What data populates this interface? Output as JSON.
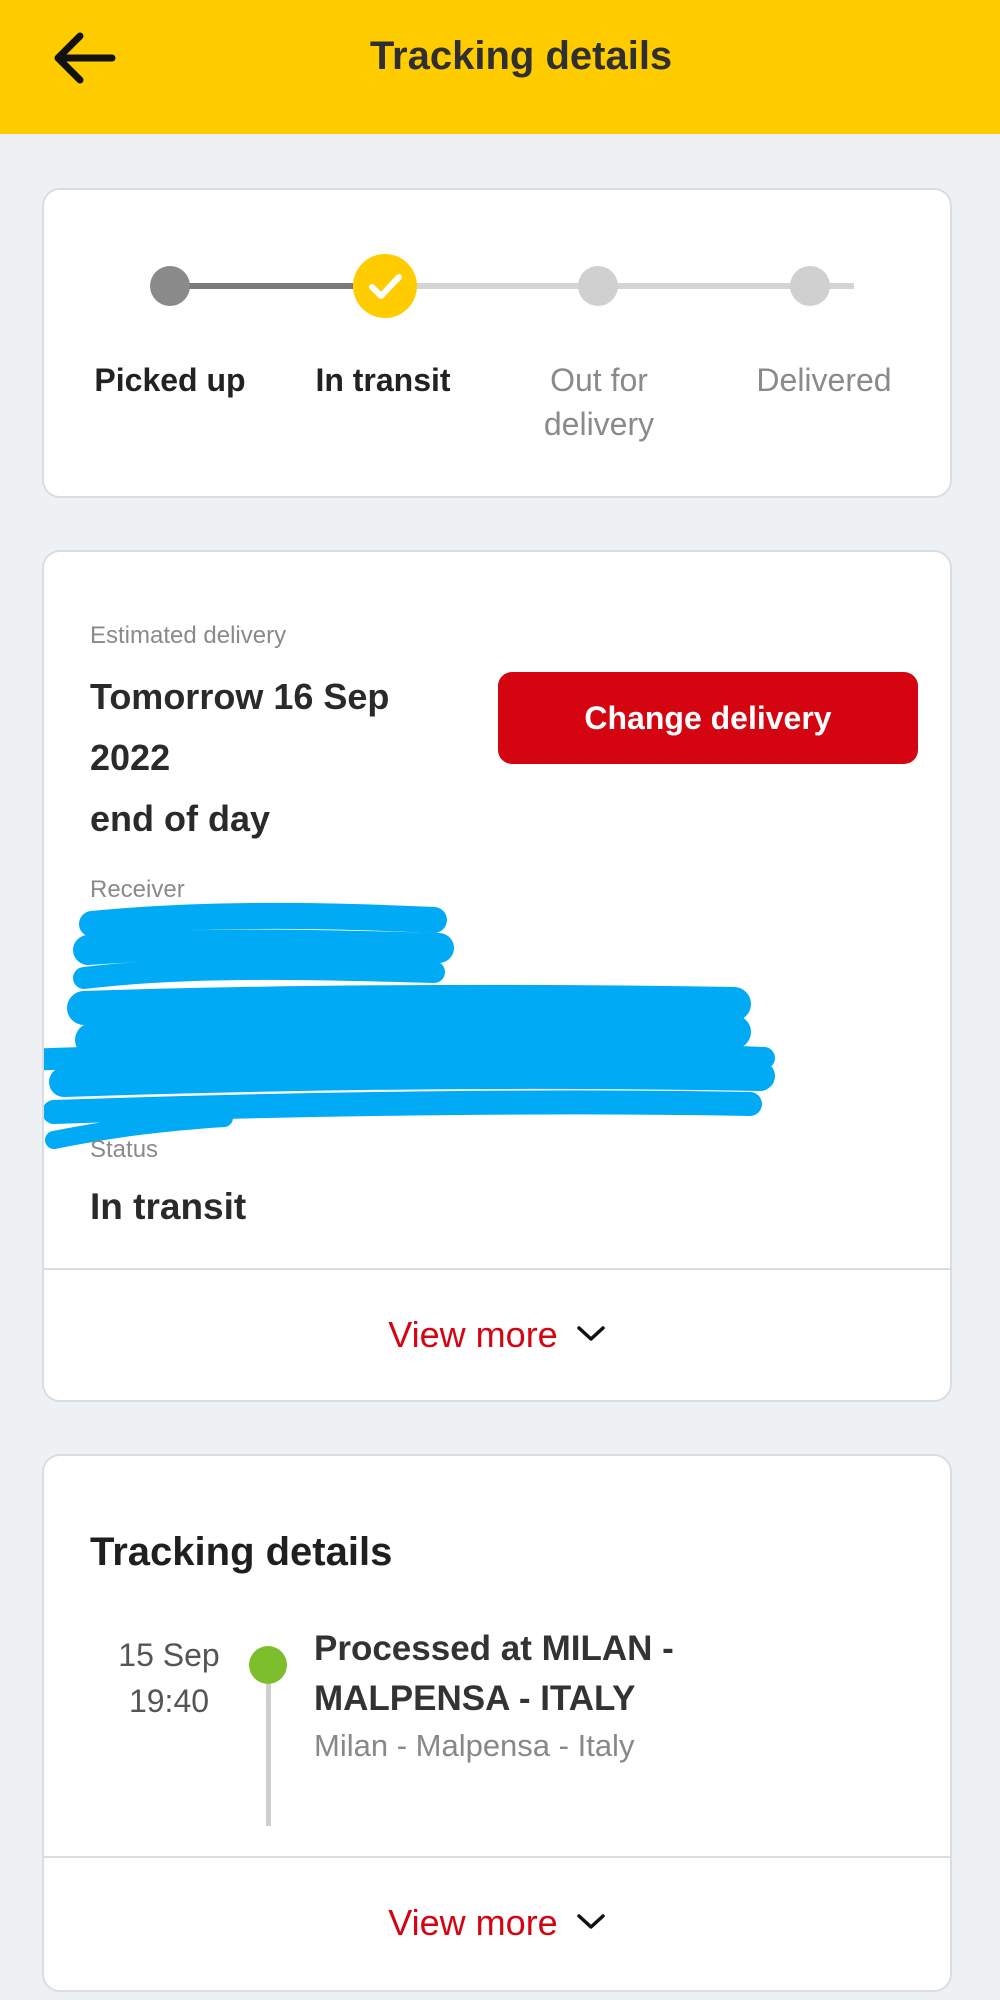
{
  "header": {
    "title": "Tracking details"
  },
  "progress": {
    "steps": [
      {
        "label": "Picked up",
        "state": "done"
      },
      {
        "label": "In transit",
        "state": "current"
      },
      {
        "label": "Out for delivery",
        "state": "pending"
      },
      {
        "label": "Delivered",
        "state": "pending"
      }
    ]
  },
  "delivery": {
    "estimated_label": "Estimated delivery",
    "date_line1": "Tomorrow 16 Sep",
    "date_line2": "2022",
    "date_line3": "end of day",
    "change_button": "Change delivery",
    "receiver_label": "Receiver",
    "status_label": "Status",
    "status_value": "In transit",
    "view_more": "View more"
  },
  "tracking": {
    "title": "Tracking details",
    "events": [
      {
        "date": "15 Sep",
        "time": "19:40",
        "title": "Processed at MILAN - MALPENSA - ITALY",
        "location": "Milan - Malpensa - Italy"
      }
    ],
    "view_more": "View more"
  },
  "colors": {
    "brand_yellow": "#ffcc00",
    "brand_red": "#d40511",
    "event_green": "#7dbe2c",
    "redaction_blue": "#00aaf5"
  }
}
